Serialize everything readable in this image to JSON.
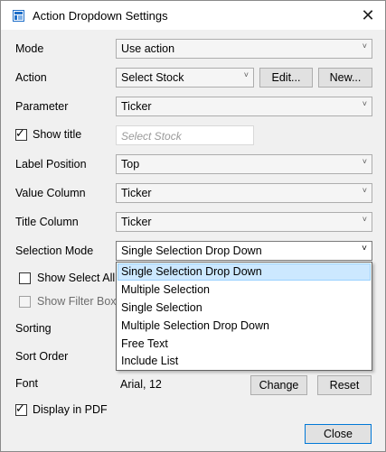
{
  "window": {
    "title": "Action Dropdown Settings",
    "close_glyph": "✕"
  },
  "labels": {
    "mode": "Mode",
    "action": "Action",
    "parameter": "Parameter",
    "label_position": "Label Position",
    "value_column": "Value Column",
    "title_column": "Title Column",
    "selection_mode": "Selection Mode",
    "sorting": "Sorting",
    "sort_order": "Sort Order",
    "font": "Font"
  },
  "fields": {
    "mode": "Use action",
    "action": "Select Stock",
    "parameter": "Ticker",
    "label_position": "Top",
    "value_column": "Ticker",
    "title_column": "Ticker",
    "selection_mode": "Single Selection Drop Down",
    "font": "Arial, 12"
  },
  "show_title": {
    "label": "Show title",
    "checked": true,
    "placeholder": "Select Stock"
  },
  "show_select_all": {
    "label": "Show Select All",
    "checked": false
  },
  "show_filter_box": {
    "label": "Show Filter Box",
    "checked": false,
    "enabled": false
  },
  "display_in_pdf": {
    "label": "Display in PDF",
    "checked": true
  },
  "buttons": {
    "edit": "Edit...",
    "new": "New...",
    "change": "Change",
    "reset": "Reset",
    "close": "Close"
  },
  "selection_mode_options": [
    "Single Selection Drop Down",
    "Multiple Selection",
    "Single Selection",
    "Multiple Selection Drop Down",
    "Free Text",
    "Include List"
  ],
  "selection_mode_selected": "Single Selection Drop Down",
  "glyphs": {
    "check": "✓",
    "chevron_small": "˅",
    "chevron_bold": "⌄"
  },
  "colors": {
    "accent": "#0078d7",
    "selected_bg": "#cce8ff",
    "icon": "#1e6ec8"
  }
}
